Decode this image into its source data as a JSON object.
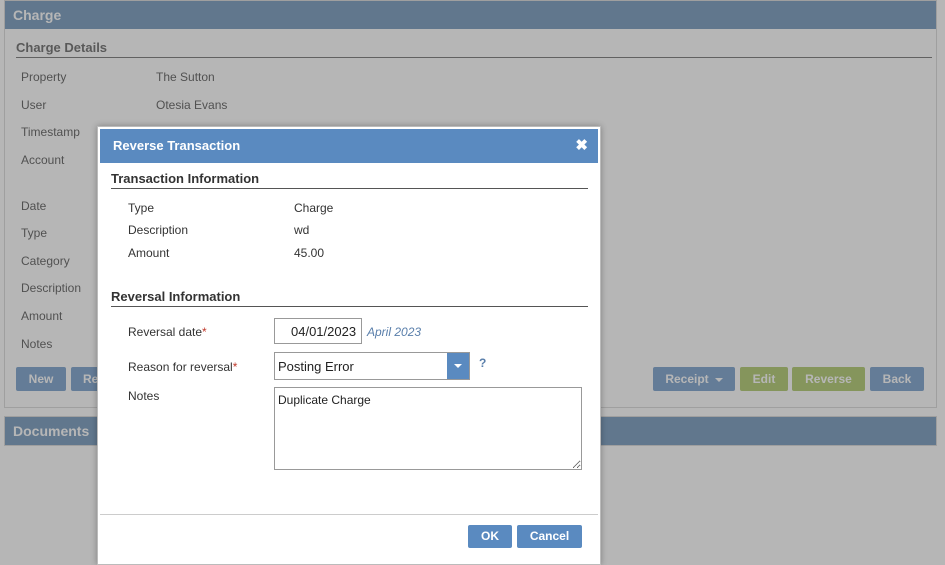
{
  "page": {
    "panel_title": "Charge",
    "section_title": "Charge Details",
    "fields": [
      {
        "label": "Property",
        "value": "The Sutton"
      },
      {
        "label": "User",
        "value": "Otesia Evans"
      },
      {
        "label": "Timestamp",
        "value": ""
      },
      {
        "label": "Account",
        "value": ""
      },
      {
        "label": "Date",
        "value": ""
      },
      {
        "label": "Type",
        "value": ""
      },
      {
        "label": "Category",
        "value": ""
      },
      {
        "label": "Description",
        "value": ""
      },
      {
        "label": "Amount",
        "value": ""
      },
      {
        "label": "Notes",
        "value": ""
      }
    ],
    "buttons": {
      "new": "New",
      "partial": "Re",
      "receipt": "Receipt",
      "edit": "Edit",
      "reverse": "Reverse",
      "back": "Back"
    },
    "documents_title": "Documents"
  },
  "modal": {
    "title": "Reverse Transaction",
    "close_icon": "close-icon",
    "transaction_section": "Transaction Information",
    "transaction": [
      {
        "label": "Type",
        "value": "Charge"
      },
      {
        "label": "Description",
        "value": "wd"
      },
      {
        "label": "Amount",
        "value": "45.00"
      }
    ],
    "reversal_section": "Reversal Information",
    "reversal_date_label": "Reversal date",
    "reversal_date_value": "04/01/2023",
    "reversal_date_hint": "April 2023",
    "reason_label": "Reason for reversal",
    "reason_value": "Posting Error",
    "help_text": "?",
    "notes_label": "Notes",
    "notes_value": "Duplicate Charge",
    "required_marker": "*",
    "ok_label": "OK",
    "cancel_label": "Cancel"
  },
  "colors": {
    "header_blue": "#5480ad",
    "button_blue": "#5a8ac0",
    "button_green": "#9cbc4a",
    "required_red": "#c0392b"
  }
}
